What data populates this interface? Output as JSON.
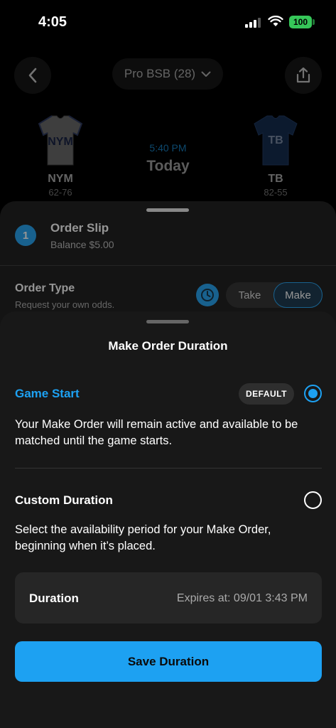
{
  "status_bar": {
    "time": "4:05",
    "battery": "100"
  },
  "game": {
    "league_label": "Pro BSB (28)",
    "away": {
      "jersey": "NYM",
      "abbr": "NYM",
      "record": "62-76"
    },
    "home": {
      "jersey": "TB",
      "abbr": "TB",
      "record": "82-55"
    },
    "time": "5:40 PM",
    "day": "Today"
  },
  "order_slip": {
    "number": "1",
    "title": "Order Slip",
    "balance": "Balance $5.00",
    "order_type_title": "Order Type",
    "order_type_sub": "Request your own odds.",
    "options": [
      "Take",
      "Make"
    ],
    "selected": "Make"
  },
  "duration_sheet": {
    "title": "Make Order Duration",
    "game_start": {
      "title": "Game Start",
      "badge": "DEFAULT",
      "description": "Your Make Order will remain active and available to be matched until the game starts.",
      "selected": true
    },
    "custom": {
      "title": "Custom Duration",
      "description": "Select the availability period for your Make Order, beginning when it’s placed.",
      "selected": false
    },
    "duration_label": "Duration",
    "duration_value": "Expires at: 09/01 3:43 PM",
    "save_label": "Save Duration"
  },
  "colors": {
    "accent": "#1da1f2",
    "sheet_bg": "#181818",
    "battery": "#36c759"
  }
}
